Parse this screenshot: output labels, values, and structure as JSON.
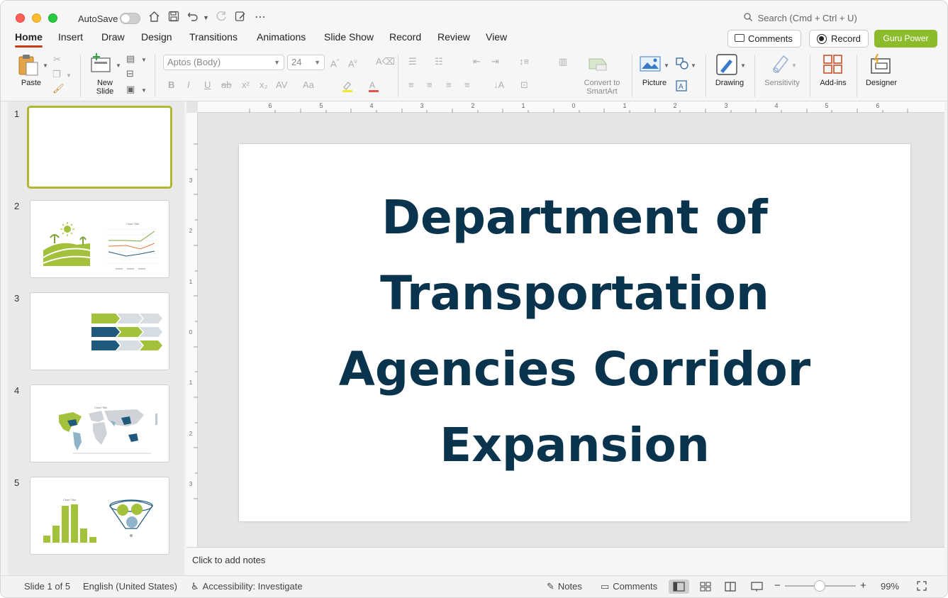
{
  "titlebar": {
    "autosave_label": "AutoSave",
    "search_placeholder": "Search (Cmd + Ctrl + U)"
  },
  "tabs": [
    "Home",
    "Insert",
    "Draw",
    "Design",
    "Transitions",
    "Animations",
    "Slide Show",
    "Record",
    "Review",
    "View"
  ],
  "active_tab": "Home",
  "tabbar_buttons": {
    "comments": "Comments",
    "record": "Record",
    "guru": "Guru Power"
  },
  "ribbon": {
    "paste": "Paste",
    "new_slide_line1": "New",
    "new_slide_line2": "Slide",
    "font_name": "Aptos (Body)",
    "font_size": "24",
    "convert_line1": "Convert to",
    "convert_line2": "SmartArt",
    "picture": "Picture",
    "drawing": "Drawing",
    "sensitivity": "Sensitivity",
    "addins": "Add-ins",
    "designer": "Designer"
  },
  "thumbnails": [
    "1",
    "2",
    "3",
    "4",
    "5"
  ],
  "slide": {
    "title_lines": [
      "Department of",
      "Transportation",
      "Agencies Corridor",
      "Expansion"
    ]
  },
  "notes_placeholder": "Click to add notes",
  "statusbar": {
    "slide_info": "Slide 1 of 5",
    "language": "English (United States)",
    "accessibility": "Accessibility: Investigate",
    "notes": "Notes",
    "comments": "Comments",
    "zoom": "99%"
  },
  "ruler": {
    "h_labels": [
      "6",
      "5",
      "4",
      "3",
      "2",
      "1",
      "0",
      "1",
      "2",
      "3",
      "4",
      "5",
      "6"
    ],
    "v_labels": [
      "3",
      "2",
      "1",
      "0",
      "1",
      "2",
      "3"
    ]
  },
  "colors": {
    "accent_tab": "#c43e1c",
    "guru_green": "#8cbc2c",
    "title_navy": "#0a344d",
    "thumb_green": "#a4c13b",
    "thumb_blue": "#1f5a7d"
  }
}
